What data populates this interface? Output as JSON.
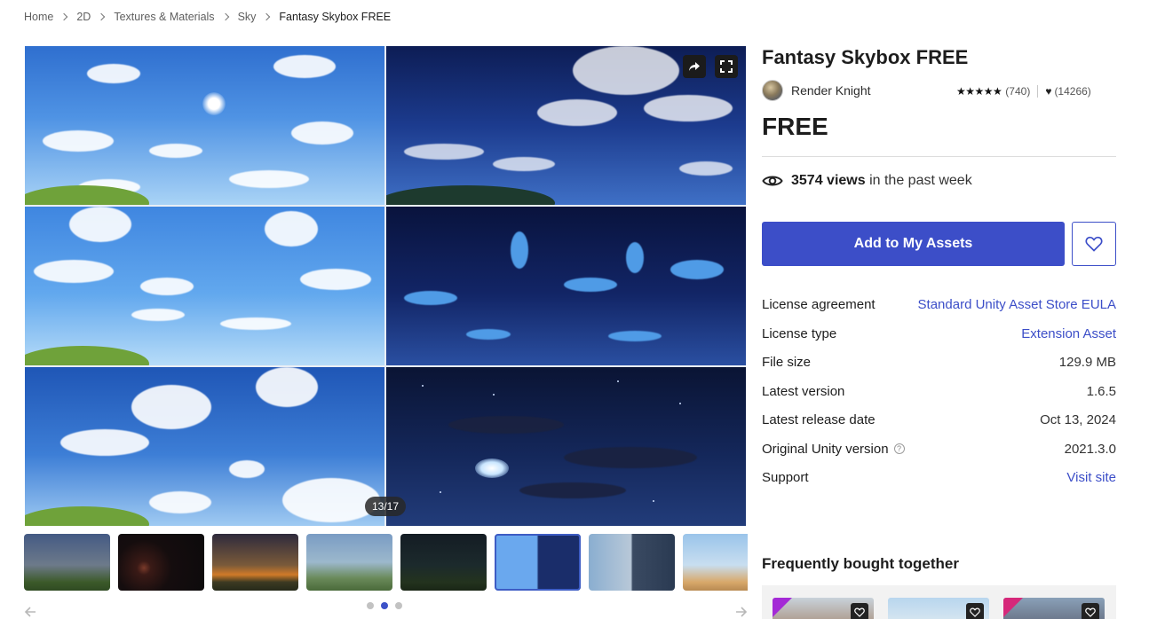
{
  "breadcrumb": {
    "items": [
      "Home",
      "2D",
      "Textures & Materials",
      "Sky"
    ],
    "current": "Fantasy Skybox FREE"
  },
  "gallery": {
    "counter": "13/17",
    "share_icon": "share-icon",
    "fullscreen_icon": "fullscreen-icon",
    "thumbnail_count": 8,
    "active_thumbnail": 6,
    "carousel_pages": 3,
    "active_page": 2
  },
  "product": {
    "title": "Fantasy Skybox FREE",
    "publisher": "Render Knight",
    "rating_stars": "★★★★★",
    "rating_count": "(740)",
    "favorites_count": "(14266)",
    "price": "FREE",
    "views_count": "3574 views",
    "views_suffix": "in the past week",
    "add_button": "Add to My Assets"
  },
  "info": {
    "rows": [
      {
        "label": "License agreement",
        "value": "Standard Unity Asset Store EULA"
      },
      {
        "label": "License type",
        "value": "Extension Asset"
      },
      {
        "label": "File size",
        "value": "129.9 MB"
      },
      {
        "label": "Latest version",
        "value": "1.6.5"
      },
      {
        "label": "Latest release date",
        "value": "Oct 13, 2024"
      },
      {
        "label": "Original Unity version",
        "value": "2021.3.0"
      },
      {
        "label": "Support",
        "value": "Visit site"
      }
    ]
  },
  "frequently_bought": {
    "title": "Frequently bought together"
  },
  "colors": {
    "accent": "#3c4ec8",
    "link": "#3c4ec8"
  }
}
